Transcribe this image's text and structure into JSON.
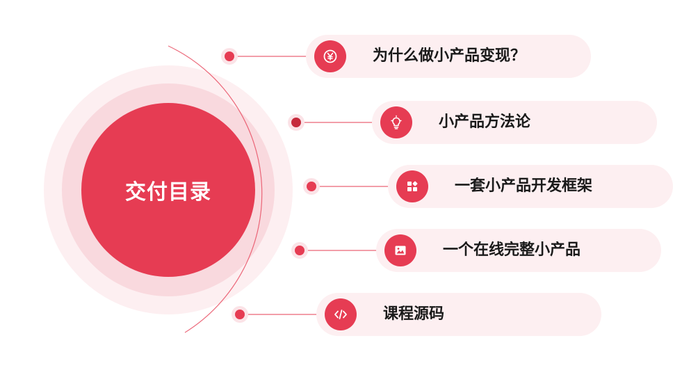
{
  "center": {
    "title": "交付目录"
  },
  "items": [
    {
      "label": "为什么做小产品变现？",
      "icon": "yen-coin-icon"
    },
    {
      "label": "小产品方法论",
      "icon": "lightbulb-icon"
    },
    {
      "label": "一套小产品开发框架",
      "icon": "app-blocks-icon"
    },
    {
      "label": "一个在线完整小产品",
      "icon": "image-icon"
    },
    {
      "label": "课程源码",
      "icon": "code-icon"
    }
  ],
  "colors": {
    "accent": "#e63c53",
    "dark_accent": "#c62a3c",
    "pill_bg": "#fdeff1",
    "ring_light": "#f9d9de"
  }
}
